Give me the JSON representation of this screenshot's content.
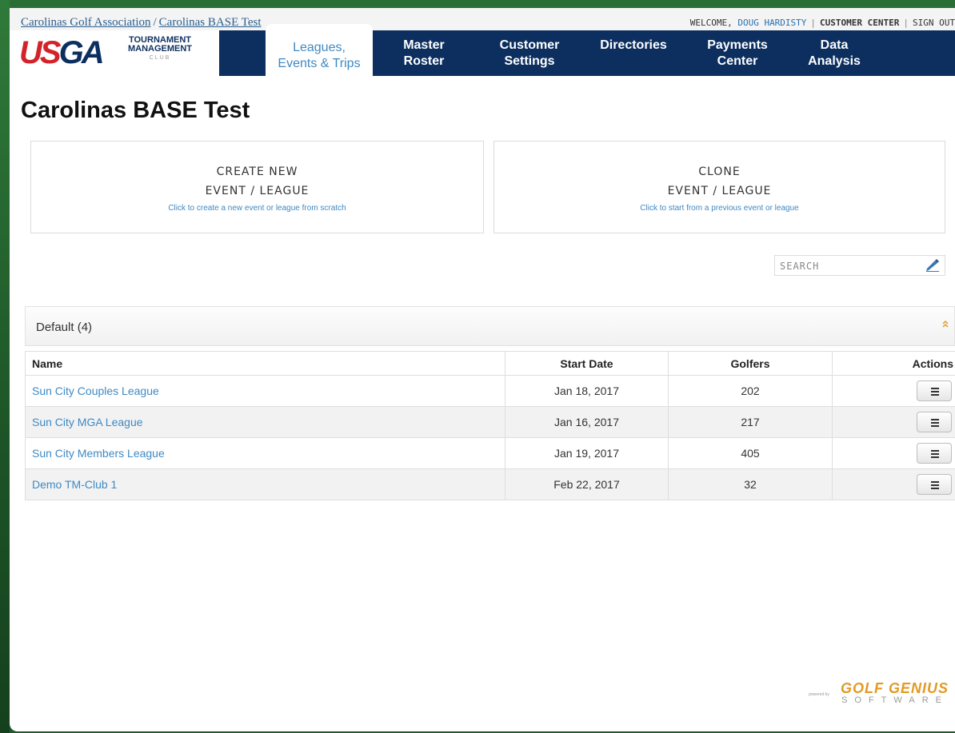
{
  "breadcrumb": {
    "org": "Carolinas Golf Association",
    "separator": "/",
    "project": "Carolinas BASE Test"
  },
  "userbar": {
    "welcome": "WELCOME,",
    "user": "DOUG HARDISTY",
    "divider": "|",
    "customer_center": "CUSTOMER CENTER",
    "sign_out": "SIGN OUT"
  },
  "logo": {
    "usga_u": "US",
    "usga_rest": "GA",
    "tm_line1": "TOURNAMENT",
    "tm_line2": "MANAGEMENT",
    "club": "CLUB"
  },
  "nav": {
    "tabs": [
      {
        "line1": "Leagues,",
        "line2": "Events & Trips"
      },
      {
        "line1": "Master",
        "line2": "Roster"
      },
      {
        "line1": "Customer",
        "line2": "Settings"
      },
      {
        "line1": "Directories",
        "line2": ""
      },
      {
        "line1": "Payments",
        "line2": "Center"
      },
      {
        "line1": "Data",
        "line2": "Analysis"
      }
    ]
  },
  "page_title": "Carolinas BASE Test",
  "cards": {
    "create": {
      "line1": "CREATE NEW",
      "line2": "EVENT / LEAGUE",
      "sub": "Click to create a new event or league from scratch"
    },
    "clone": {
      "line1": "CLONE",
      "line2": "EVENT / LEAGUE",
      "sub": "Click to start from a previous event or league"
    }
  },
  "search": {
    "placeholder": "SEARCH"
  },
  "group": {
    "name": "Default (4)"
  },
  "table": {
    "headers": {
      "name": "Name",
      "start_date": "Start Date",
      "golfers": "Golfers",
      "actions": "Actions"
    },
    "rows": [
      {
        "name": "Sun City Couples League",
        "start_date": "Jan 18, 2017",
        "golfers": "202"
      },
      {
        "name": "Sun City MGA League",
        "start_date": "Jan 16, 2017",
        "golfers": "217"
      },
      {
        "name": "Sun City Members League",
        "start_date": "Jan 19, 2017",
        "golfers": "405"
      },
      {
        "name": "Demo TM-Club 1",
        "start_date": "Feb 22, 2017",
        "golfers": "32"
      }
    ]
  },
  "footer": {
    "powered_by": "powered by",
    "brand_line1": "GOLF GENIUS",
    "brand_line2": "SOFTWARE"
  },
  "icons": {
    "search": "pen-eraser-icon",
    "collapse": "double-chevron-up-icon",
    "row_menu": "hamburger-icon"
  },
  "colors": {
    "nav_bg": "#0d2f5f",
    "link": "#3f89c3",
    "usga_red": "#d2232a",
    "golf_genius_orange": "#e39a24"
  }
}
